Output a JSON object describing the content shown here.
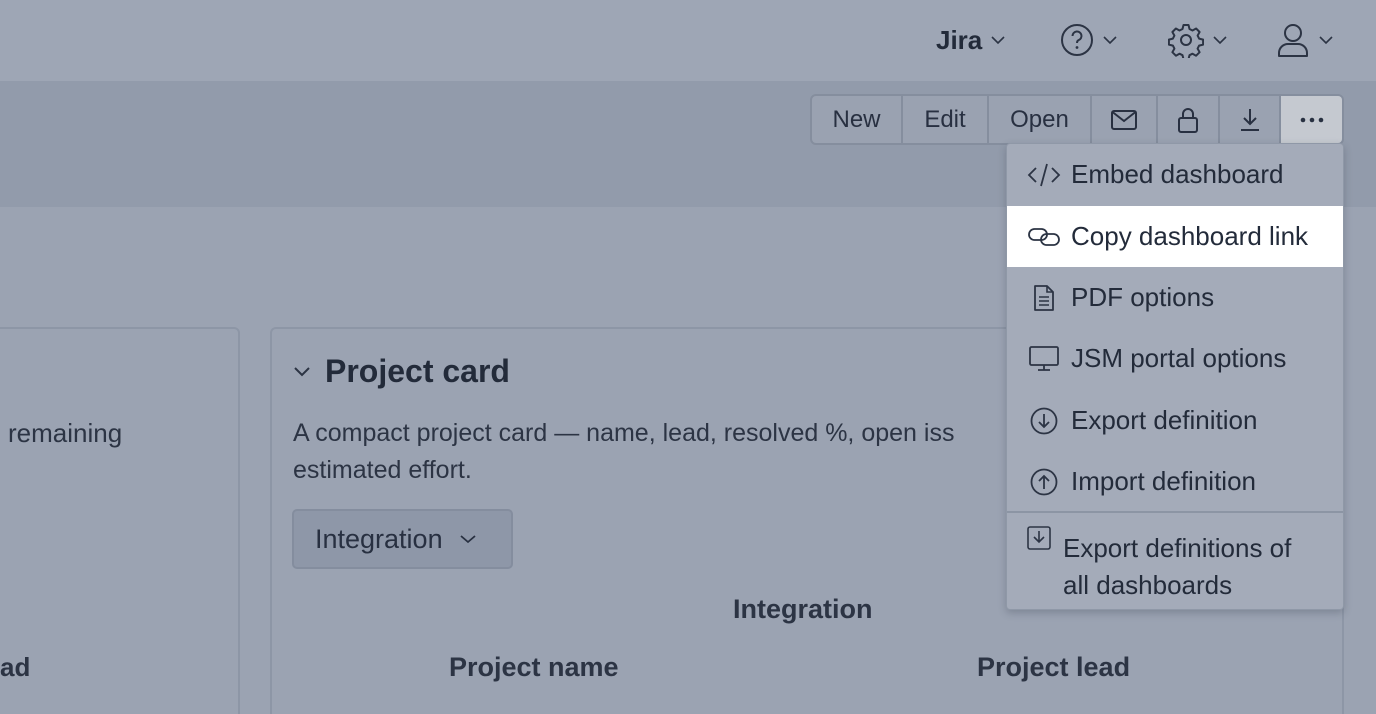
{
  "header": {
    "product_menu": "Jira",
    "icons": [
      "help-icon",
      "settings-icon",
      "user-icon"
    ]
  },
  "toolbar": {
    "new_label": "New",
    "edit_label": "Edit",
    "open_label": "Open"
  },
  "menu": {
    "items": [
      {
        "label": "Embed dashboard",
        "icon": "code-icon"
      },
      {
        "label": "Copy dashboard link",
        "icon": "link-icon",
        "active": true
      },
      {
        "label": "PDF options",
        "icon": "document-icon"
      },
      {
        "label": "JSM portal options",
        "icon": "monitor-icon"
      },
      {
        "label": "Export definition",
        "icon": "arrow-down-circle-icon"
      },
      {
        "label": "Import definition",
        "icon": "arrow-up-circle-icon"
      }
    ],
    "export_all_label": "Export definitions of all dashboards"
  },
  "left_card": {
    "text_remaining": "remaining",
    "text_lead": "ad"
  },
  "project_card": {
    "title": "Project card",
    "description_line1": "A compact project card — name, lead, resolved %, open iss",
    "description_line2": "estimated effort.",
    "selector_value": "Integration",
    "section_heading": "Integration",
    "col_project_name": "Project name",
    "col_project_lead": "Project lead"
  },
  "colors": {
    "overlay_bg": "#9ba3b2",
    "menu_bg": "#a4abb9",
    "active_item_bg": "#ffffff",
    "text": "#232b3a"
  }
}
